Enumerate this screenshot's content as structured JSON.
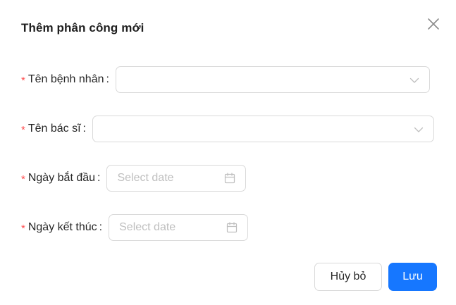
{
  "dialog": {
    "title": "Thêm phân công mới",
    "close_icon": "close-icon"
  },
  "form": {
    "required_mark": "*",
    "colon": ":",
    "patient": {
      "label": "Tên bệnh nhân",
      "value": "",
      "icon": "chevron-down-icon"
    },
    "doctor": {
      "label": "Tên bác sĩ",
      "value": "",
      "icon": "chevron-down-icon"
    },
    "start_date": {
      "label": "Ngày bắt đầu",
      "placeholder": "Select date",
      "icon": "calendar-icon"
    },
    "end_date": {
      "label": "Ngày kết thúc",
      "placeholder": "Select date",
      "icon": "calendar-icon"
    }
  },
  "footer": {
    "cancel_label": "Hủy bỏ",
    "save_label": "Lưu"
  },
  "colors": {
    "primary": "#1677ff",
    "required": "#ff4d4f",
    "border": "#d9d9d9",
    "placeholder": "#bfbfbf"
  }
}
